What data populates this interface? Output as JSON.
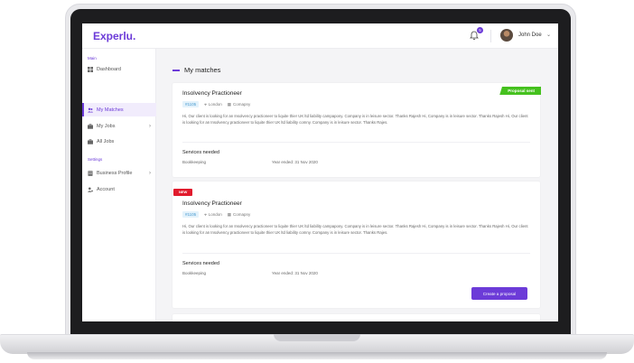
{
  "app": {
    "logo": "Experlu.",
    "notification_count": "5",
    "user_name": "John Doe"
  },
  "sidebar": {
    "section_main": "Main",
    "section_settings": "Settings",
    "items": [
      {
        "label": "Dashboard",
        "icon": "grid-icon"
      },
      {
        "label": "My Matches",
        "icon": "users-icon",
        "active": true
      },
      {
        "label": "My Jobs",
        "icon": "briefcase-icon",
        "has_chevron": true
      },
      {
        "label": "All Jobs",
        "icon": "briefcase-icon"
      },
      {
        "label": "Business Profile",
        "icon": "building-icon",
        "has_chevron": true
      },
      {
        "label": "Account",
        "icon": "user-cog-icon"
      }
    ]
  },
  "main": {
    "page_title": "My matches",
    "cards": [
      {
        "ribbon": "Proposal sent",
        "title": "Insolvency Practioneer",
        "tag": "#1105",
        "location": "London",
        "company": "Comapny",
        "description": "Hi, Our client is looking for an Insolvency practioneer to liquite thier UK ltd liability campapony. Company is in leisure sector. Thanks Rajesh Hi, Company is in leisure sector. Thanks Rajesh Hi, Our client is looking for an Insolvency practioneer to liquite thier UK ltd liability comny. Company is in leisure sector. Thanks Rajes.",
        "services_label": "Services needed",
        "service": "Bookkeeping",
        "year_end": "Year ended: 31 Nov 2020"
      },
      {
        "ribbon": "NEW",
        "title": "Insolvency Practioneer",
        "tag": "#1105",
        "location": "London",
        "company": "Comapny",
        "description": "Hi, Our client is looking for an Insolvency practioneer to liquite thier UK ltd liability campapony. Company is in leisure sector. Thanks Rajesh Hi, Company is in leisure sector. Thanks Rajesh Hi, Our client is looking for an Insolvency practioneer to liquite thier UK ltd liability comny. Company is in leisure sector. Thanks Rajes.",
        "services_label": "Services needed",
        "service": "Bookkeeping",
        "year_end": "Year ended: 31 Nov 2020",
        "button": "Create a proposal"
      }
    ]
  },
  "colors": {
    "accent": "#6c3bd8",
    "sent": "#45c11e",
    "new": "#e11b2d"
  }
}
